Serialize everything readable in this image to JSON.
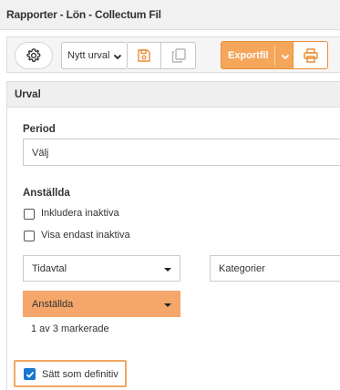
{
  "window": {
    "title": "Rapporter - Lön - Collectum Fil"
  },
  "toolbar": {
    "settings_icon": "gear-icon",
    "selection_value": "Nytt urval",
    "save_icon": "save-icon",
    "copy_icon": "copy-icon",
    "export_label": "Exportfil",
    "print_icon": "printer-icon"
  },
  "section": {
    "title": "Urval",
    "period_label": "Period",
    "period_value": "Välj",
    "employees_label": "Anställda",
    "include_inactive_label": "Inkludera inaktiva",
    "include_inactive_checked": false,
    "show_only_inactive_label": "Visa endast inaktiva",
    "show_only_inactive_checked": false,
    "tidavtal_label": "Tidavtal",
    "kategorier_label": "Kategorier",
    "anstallda_dropdown_label": "Anställda",
    "selected_count_text": "1 av 3 markerade",
    "definitive_label": "Sätt som definitiv",
    "definitive_checked": true
  },
  "colors": {
    "accent": "#f5a65b",
    "checkbox_blue": "#1976d2"
  }
}
